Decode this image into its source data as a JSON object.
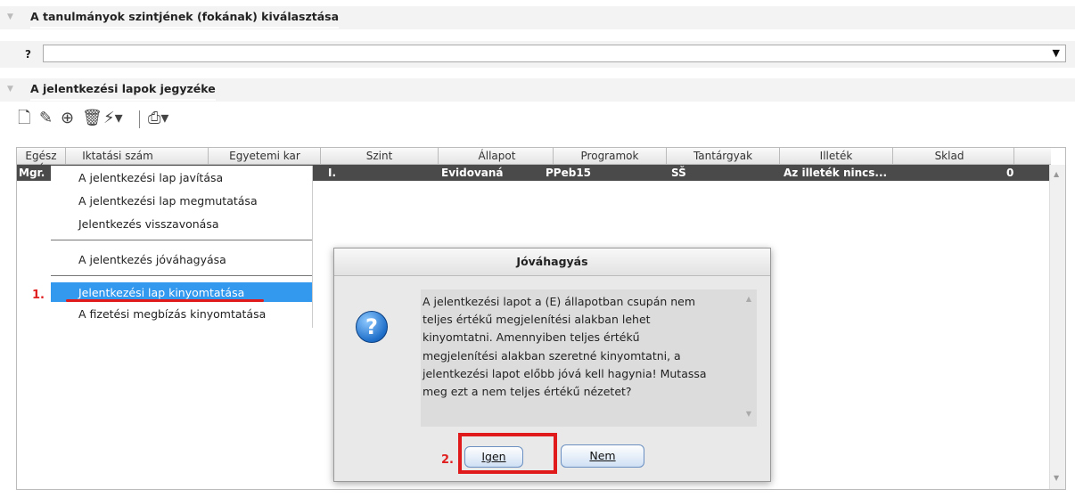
{
  "section1": {
    "title": "A tanulmányok szintjének (fokának) kiválasztása"
  },
  "combo": {
    "help": "?",
    "value": ""
  },
  "section2": {
    "title": "A jelentkezési lapok jegyzéke"
  },
  "grid": {
    "columns": [
      "Egész név",
      "Iktatási szám",
      "Egyetemi kar",
      "Szint",
      "Állapot",
      "Programok",
      "Tantárgyak",
      "Illeték",
      "Sklad"
    ],
    "row": {
      "name": "Mgr.",
      "level": "I.",
      "status": "Evidovaná",
      "program": "PPeb15",
      "subject": "SŠ",
      "fee": "Az illeték nincs...",
      "sklad": "0"
    }
  },
  "menu": {
    "items": [
      "A jelentkezési lap javítása",
      "A jelentkezési lap megmutatása",
      "Jelentkezés visszavonása",
      "A jelentkezés jóváhagyása",
      "Jelentkezési lap kinyomtatása",
      "A fizetési megbízás kinyomtatása"
    ],
    "step_label": "1."
  },
  "dialog": {
    "title": "Jóváhagyás",
    "message_lines": [
      "A jelentkezési lapot a (E) állapotban csupán nem",
      "teljes értékű megjelenítési alakban lehet",
      "kinyomtatni. Amennyiben teljes értékű",
      "megjelenítési alakban szeretné kinyomtatni, a",
      "jelentkezési lapot előbb jóvá kell hagynia! Mutassa",
      "meg ezt a nem teljes értékű nézetet?"
    ],
    "yes_label": "Igen",
    "no_label": "Nem",
    "step_label": "2."
  },
  "colors": {
    "highlight": "#e01a1a",
    "selection": "#3399ee",
    "row_bg": "#4a4a4a"
  }
}
